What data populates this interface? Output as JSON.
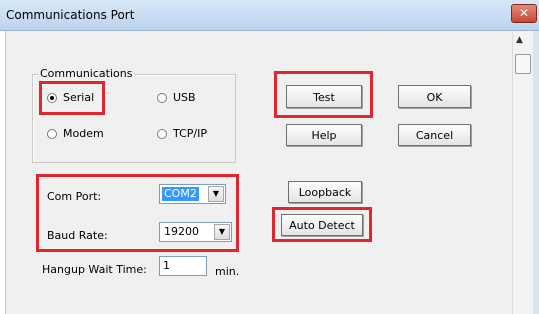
{
  "window": {
    "title": "Communications Port",
    "close_glyph": "✕"
  },
  "communications": {
    "group_label": "Communications",
    "options": [
      {
        "label": "Serial",
        "checked": true
      },
      {
        "label": "USB",
        "checked": false
      },
      {
        "label": "Modem",
        "checked": false
      },
      {
        "label": "TCP/IP",
        "checked": false
      }
    ]
  },
  "settings": {
    "com_port_label": "Com Port:",
    "com_port_value": "COM2",
    "baud_rate_label": "Baud Rate:",
    "baud_rate_value": "19200",
    "hangup_label": "Hangup Wait Time:",
    "hangup_value": "1",
    "hangup_unit": "min."
  },
  "buttons": {
    "test": "Test",
    "ok": "OK",
    "help": "Help",
    "cancel": "Cancel",
    "loopback": "Loopback",
    "auto_detect": "Auto Detect"
  },
  "icons": {
    "dropdown_arrow": "▼",
    "scroll_up": "▲"
  },
  "colors": {
    "highlight": "#e0262f",
    "selection": "#3399ff"
  }
}
